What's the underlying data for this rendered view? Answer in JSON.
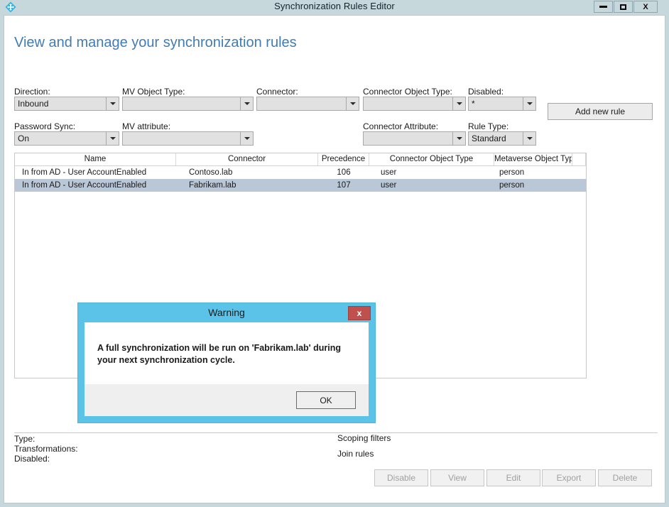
{
  "window": {
    "title": "Synchronization Rules Editor",
    "app_icon": "sync-diamond-icon",
    "minimize_label": "–",
    "maximize_label": "□",
    "close_label": "X"
  },
  "page": {
    "heading": "View and manage your synchronization rules"
  },
  "filters": [
    {
      "label": "Direction:",
      "value": "Inbound",
      "name": "direction"
    },
    {
      "label": "MV Object Type:",
      "value": "",
      "name": "mv-object-type"
    },
    {
      "label": "Connector:",
      "value": "",
      "name": "connector"
    },
    {
      "label": "Connector Object Type:",
      "value": "",
      "name": "connector-object-type"
    },
    {
      "label": "Disabled:",
      "value": "*",
      "name": "disabled"
    },
    {
      "label": "Password Sync:",
      "value": "On",
      "name": "password-sync"
    },
    {
      "label": "MV attribute:",
      "value": "",
      "name": "mv-attribute"
    },
    {
      "label": "Connector Attribute:",
      "value": "",
      "name": "connector-attribute"
    },
    {
      "label": "Rule Type:",
      "value": "Standard",
      "name": "rule-type"
    }
  ],
  "toolbar": {
    "add_new_rule": "Add new rule"
  },
  "grid": {
    "columns": [
      "Name",
      "Connector",
      "Precedence",
      "Connector Object Type",
      "Metaverse Object Type"
    ],
    "rows": [
      {
        "name": "In from AD - User AccountEnabled",
        "connector": "Contoso.lab",
        "precedence": "106",
        "connector_object_type": "user",
        "metaverse_object_type": "person",
        "selected": false
      },
      {
        "name": "In from AD - User AccountEnabled",
        "connector": "Fabrikam.lab",
        "precedence": "107",
        "connector_object_type": "user",
        "metaverse_object_type": "person",
        "selected": true
      }
    ]
  },
  "details": {
    "type_label": "Type:",
    "transformations_label": "Transformations:",
    "disabled_label": "Disabled:",
    "scoping_filters_label": "Scoping filters",
    "join_rules_label": "Join rules"
  },
  "actions": [
    {
      "label": "Disable",
      "name": "disable-button"
    },
    {
      "label": "View",
      "name": "view-button"
    },
    {
      "label": "Edit",
      "name": "edit-button"
    },
    {
      "label": "Export",
      "name": "export-button"
    },
    {
      "label": "Delete",
      "name": "delete-button"
    }
  ],
  "dialog": {
    "title": "Warning",
    "close_label": "x",
    "message": "A full synchronization will be run on 'Fabrikam.lab' during your next synchronization cycle.",
    "ok_label": "OK"
  },
  "colors": {
    "titlebar": "#c7d8dd",
    "heading": "#3f7cb6",
    "dialog_titlebar": "#5ac3e7",
    "dialog_close": "#c0504d",
    "row_selected": "#b9c7d7",
    "combo_bg": "#e1e1e1"
  }
}
